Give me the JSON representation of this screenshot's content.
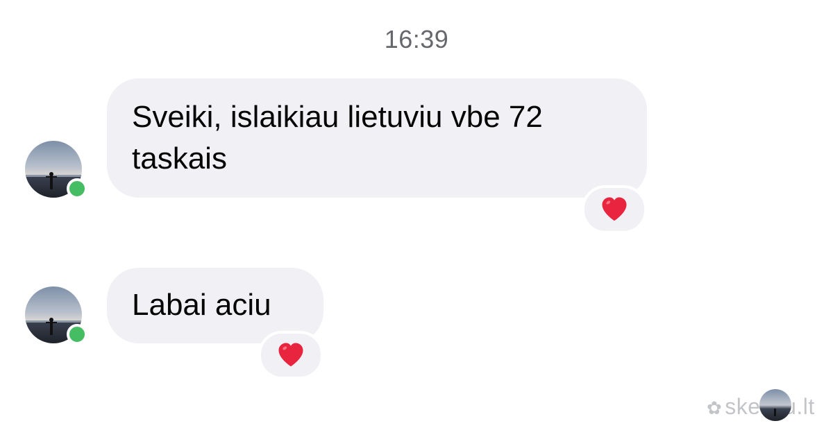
{
  "conversation": {
    "timestamp": "16:39",
    "messages": [
      {
        "text": "Sveiki, islaikiau lietuviu vbe 72 taskais",
        "reaction": "heart",
        "sender_online": true
      },
      {
        "text": "Labai aciu",
        "reaction": "heart",
        "sender_online": true
      }
    ],
    "read_receipt": "avatar"
  },
  "watermark": {
    "text": "skelbiu.lt",
    "icon": "flower-icon"
  },
  "colors": {
    "bubble_background": "#f0f0f5",
    "online_indicator": "#45bd62",
    "heart": "#e8243f",
    "timestamp_text": "#65676b"
  }
}
